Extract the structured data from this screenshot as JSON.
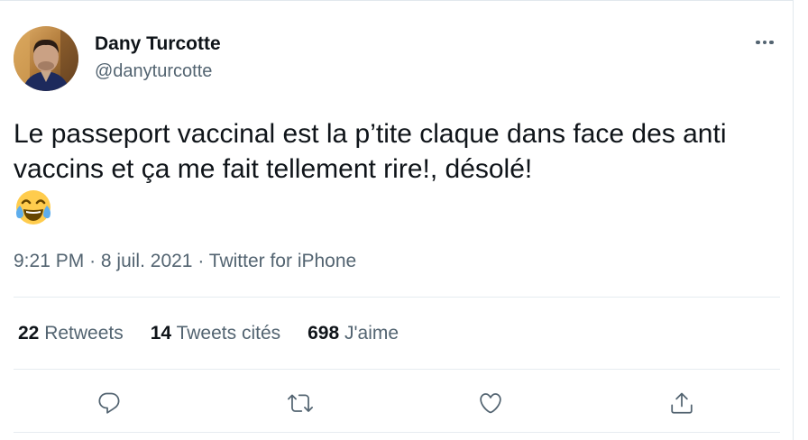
{
  "author": {
    "name": "Dany Turcotte",
    "handle": "@danyturcotte"
  },
  "tweet": {
    "text": "Le passeport vaccinal est la p’tite claque dans face des anti vaccins et ça me fait tellement rire!, désolé!",
    "emoji": "face-with-tears-of-joy"
  },
  "meta": {
    "time": "9:21 PM",
    "sep": "·",
    "date": "8 juil. 2021",
    "source": "Twitter for iPhone"
  },
  "stats": {
    "retweets_count": "22",
    "retweets_label": "Retweets",
    "quotes_count": "14",
    "quotes_label": "Tweets cités",
    "likes_count": "698",
    "likes_label": "J'aime"
  },
  "icons": {
    "more": "more-dots-icon",
    "reply": "reply-icon",
    "retweet": "retweet-icon",
    "like": "heart-icon",
    "share": "share-icon"
  },
  "colors": {
    "text": "#0f1419",
    "secondary": "#536471",
    "divider": "#e6ecf0"
  }
}
